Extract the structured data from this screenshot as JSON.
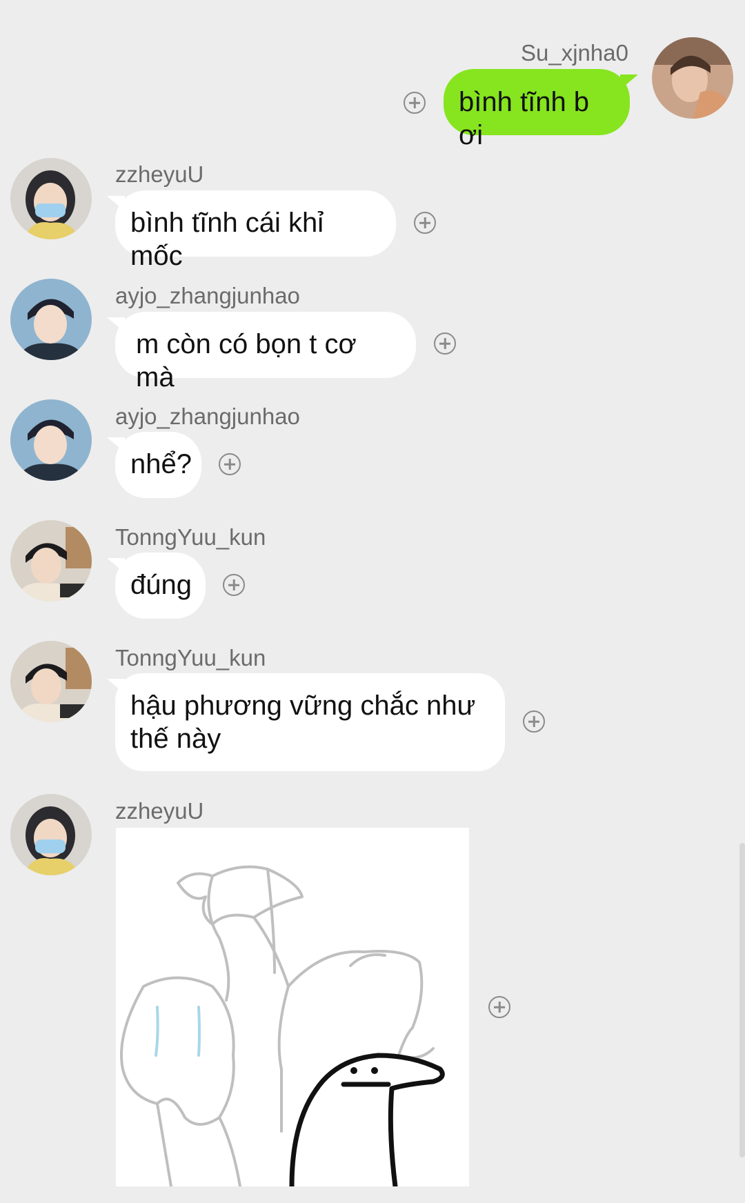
{
  "messages": [
    {
      "sender": "Su_xjnha0",
      "text": "bình tĩnh b ơi",
      "side": "right"
    },
    {
      "sender": "zzheyuU",
      "text": "bình tĩnh cái khỉ mốc",
      "side": "left"
    },
    {
      "sender": "ayjo_zhangjunhao",
      "text": "m còn có bọn t cơ mà",
      "side": "left"
    },
    {
      "sender": "ayjo_zhangjunhao",
      "text": "nhể?",
      "side": "left"
    },
    {
      "sender": "TonngYuu_kun",
      "text": "đúng",
      "side": "left"
    },
    {
      "sender": "TonngYuu_kun",
      "text": "hậu phương vững chắc như thế này",
      "side": "left"
    },
    {
      "sender": "zzheyuU",
      "type": "sticker",
      "side": "left"
    }
  ],
  "icons": {
    "add_reaction": "plus-circle-icon",
    "sticker": "doodle-crying-figures-sticker"
  },
  "colors": {
    "background": "#ededed",
    "own_bubble": "#86e51f",
    "other_bubble": "#ffffff"
  }
}
